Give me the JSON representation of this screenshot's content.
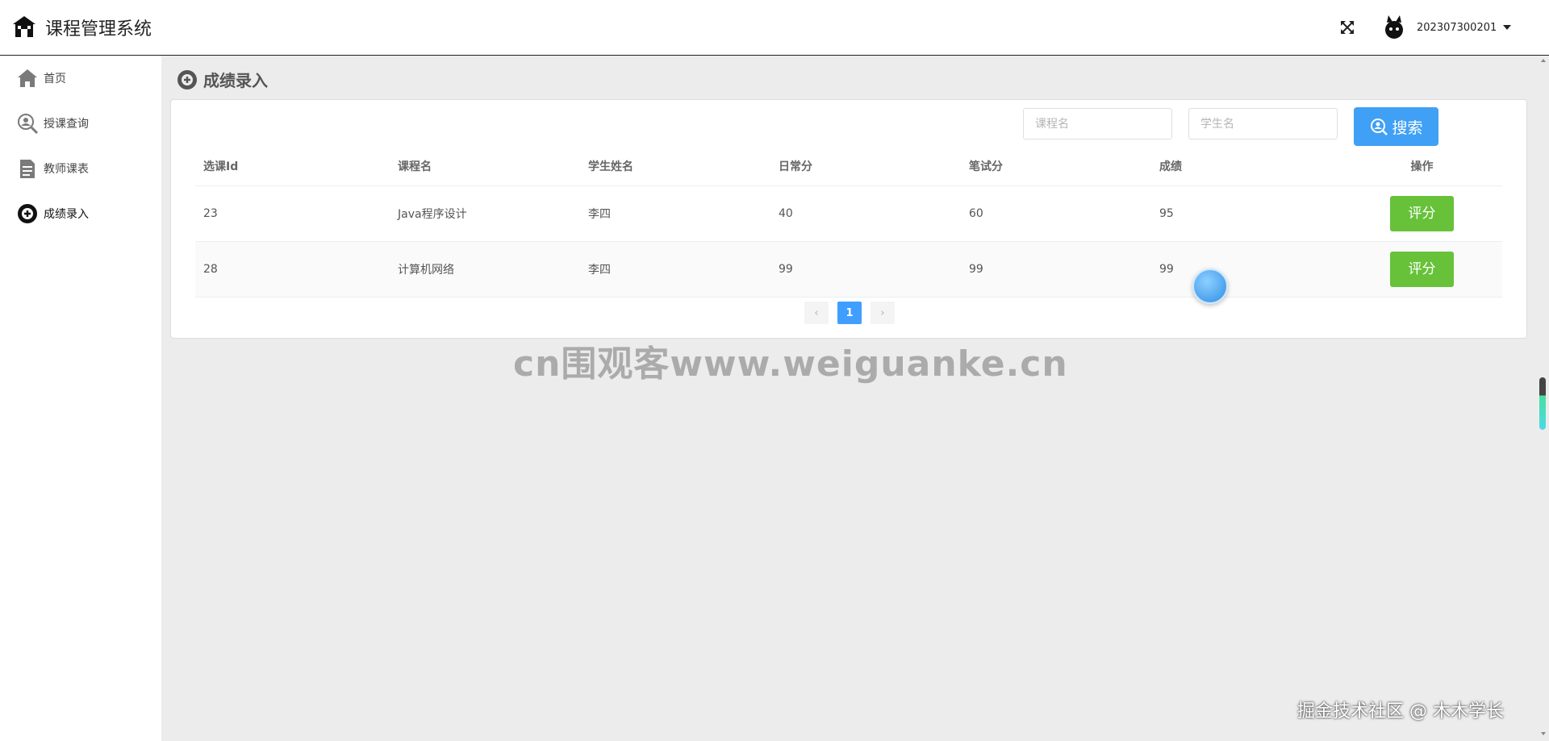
{
  "app": {
    "title": "课程管理系统",
    "brand_icon": "school-building-icon"
  },
  "header": {
    "fullscreen_icon": "fullscreen-expand-icon",
    "username": "202307300201",
    "avatar_icon": "cat-avatar-icon"
  },
  "sidebar": {
    "items": [
      {
        "label": "首页",
        "icon": "home-icon"
      },
      {
        "label": "授课查询",
        "icon": "search-user-icon"
      },
      {
        "label": "教师课表",
        "icon": "document-icon"
      },
      {
        "label": "成绩录入",
        "icon": "add-circle-icon",
        "active": true
      }
    ]
  },
  "page": {
    "title": "成绩录入",
    "title_icon": "add-circle-icon"
  },
  "search": {
    "course_placeholder": "课程名",
    "course_value": "",
    "student_placeholder": "学生名",
    "student_value": "",
    "button_label": "搜索"
  },
  "table": {
    "headers": [
      "选课Id",
      "课程名",
      "学生姓名",
      "日常分",
      "笔试分",
      "成绩",
      "操作"
    ],
    "rows": [
      {
        "id": "23",
        "course": "Java程序设计",
        "student": "李四",
        "daily": "40",
        "written": "60",
        "score": "95",
        "action": "评分"
      },
      {
        "id": "28",
        "course": "计算机网络",
        "student": "李四",
        "daily": "99",
        "written": "99",
        "score": "99",
        "action": "评分"
      }
    ]
  },
  "pagination": {
    "prev": "‹",
    "current": "1",
    "next": "›"
  },
  "watermark": "cn围观客www.weiguanke.cn",
  "footer_credit": "掘金技术社区 @ 木木学长",
  "colors": {
    "primary": "#409eff",
    "success": "#67c23a",
    "background": "#ececec"
  }
}
